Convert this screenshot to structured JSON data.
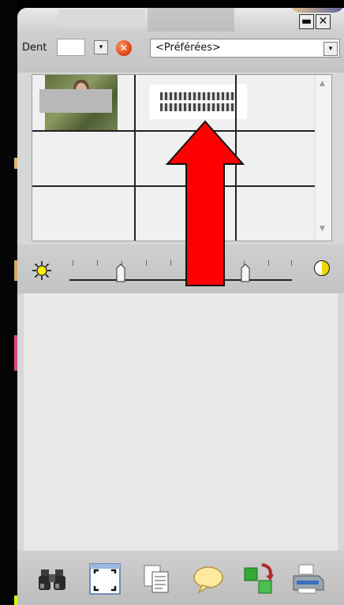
{
  "window": {
    "minimize_glyph": "▬",
    "close_glyph": "✕"
  },
  "toolbar": {
    "dent_label": "Dent",
    "dent_value": "",
    "dropdown_glyph": "▾",
    "clear_glyph": "✕",
    "favorites_selected": "<Préférées>"
  },
  "grid": {
    "columns": 3,
    "rows": 3,
    "scroll_up_glyph": "▲",
    "scroll_down_glyph": "▼"
  },
  "sliders": {
    "brightness_thumb": 0.23,
    "contrast_thumb": 0.79
  },
  "bottom_toolbar": {
    "icons": [
      "binoculars-icon",
      "fullscreen-icon",
      "copy-pages-icon",
      "comment-bubble-icon",
      "cubes-icon",
      "printer-icon"
    ]
  },
  "colors": {
    "arrow": "#ff0000",
    "window_bg": "#d7d7d7",
    "grid_line": "#222222",
    "clear_button": "#e04a1a"
  }
}
